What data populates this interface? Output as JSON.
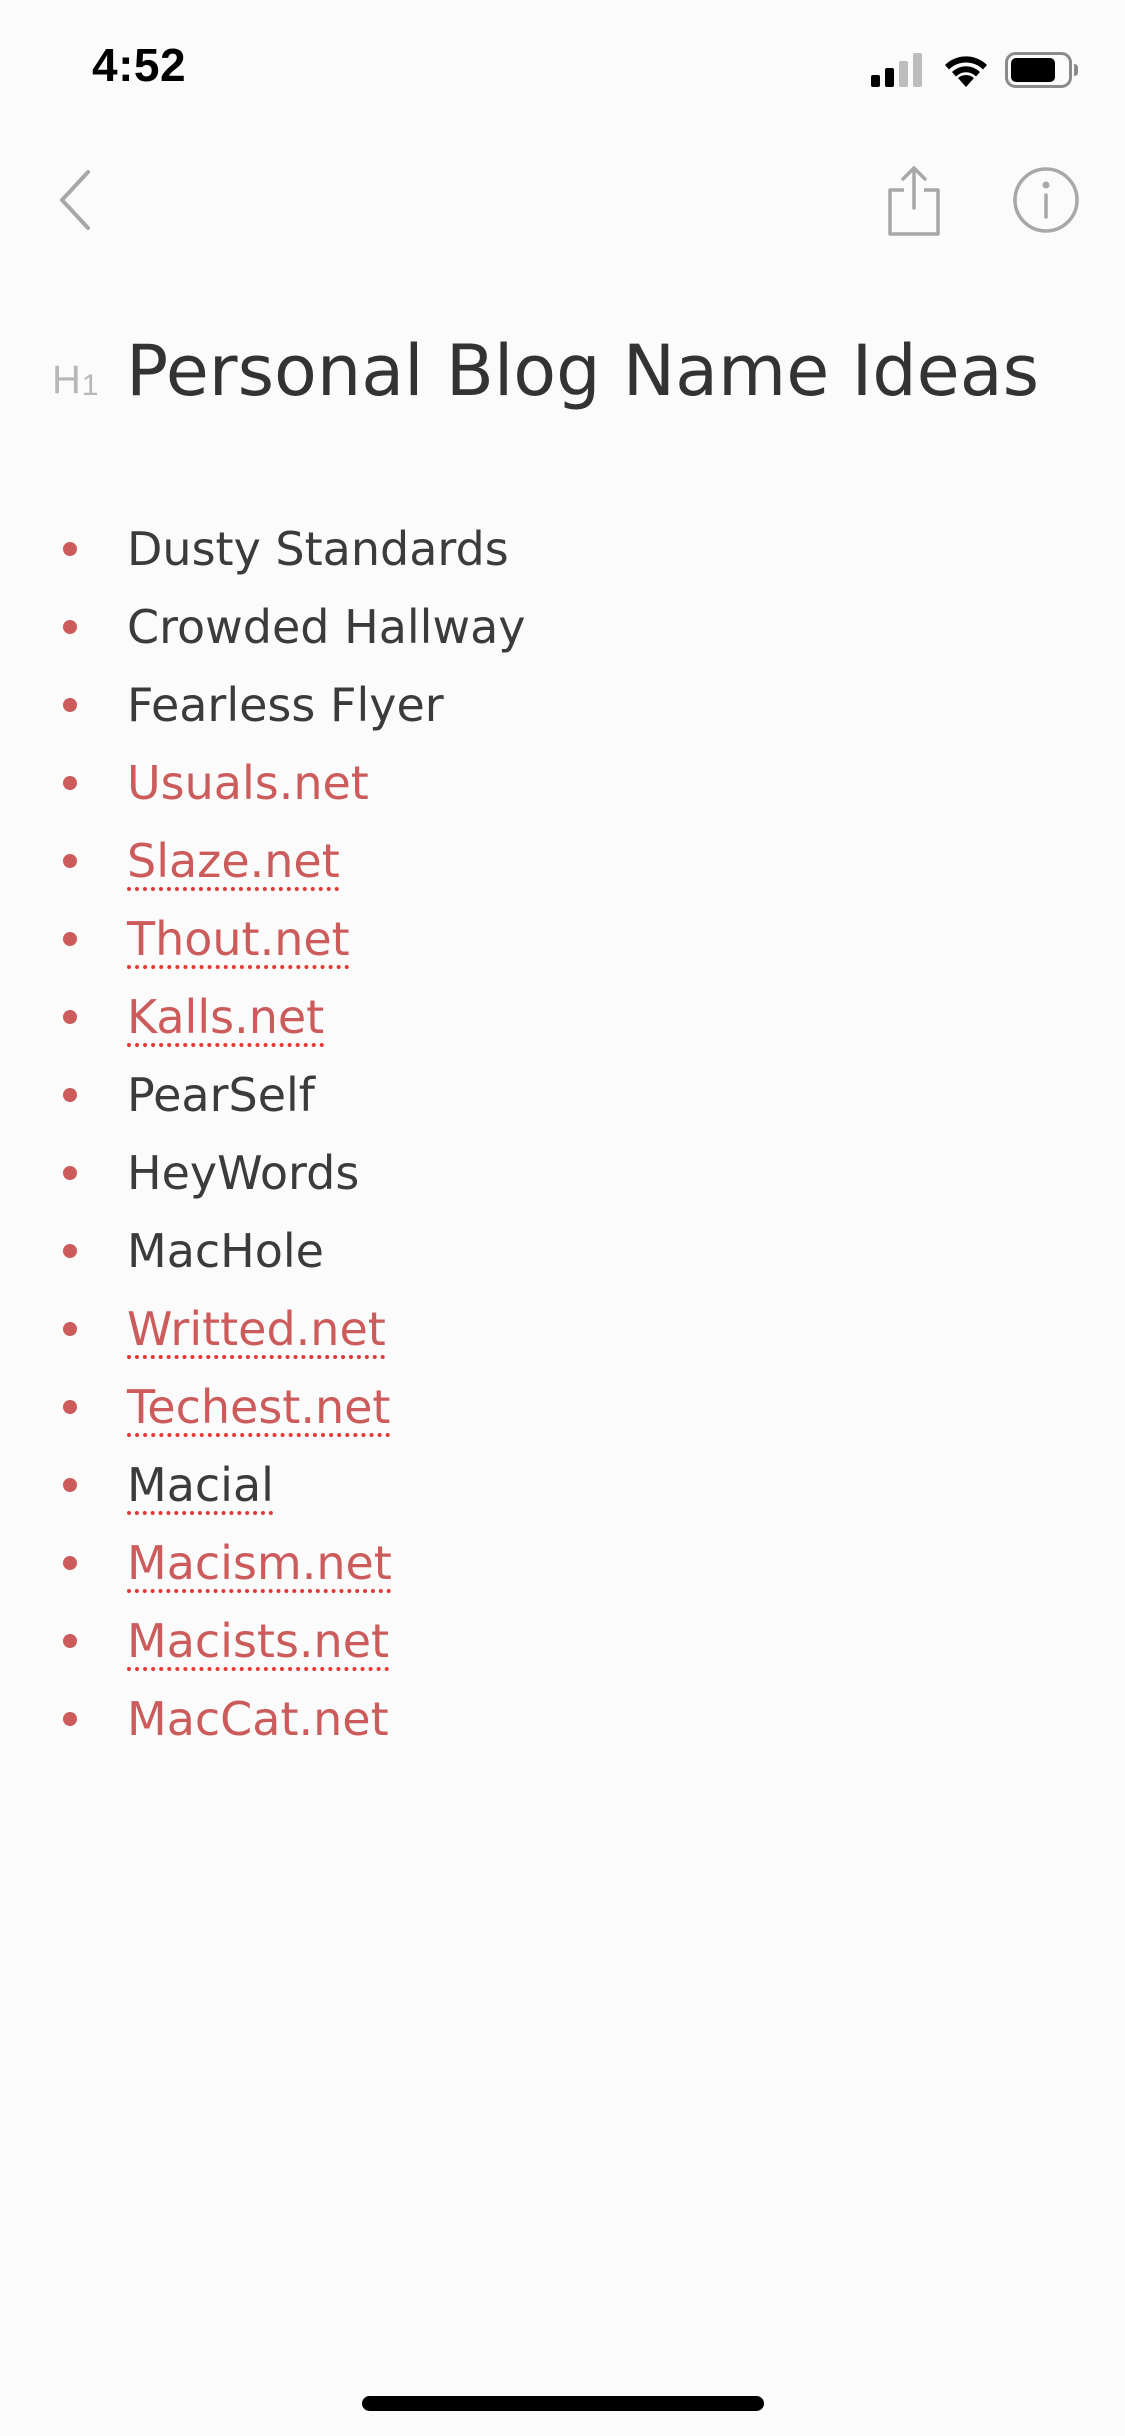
{
  "status_bar": {
    "time": "4:52",
    "signal_icon": "cellular-signal-icon",
    "wifi_icon": "wifi-icon",
    "battery_icon": "battery-icon"
  },
  "nav": {
    "back_icon": "chevron-left-icon",
    "share_icon": "share-icon",
    "info_icon": "info-icon"
  },
  "document": {
    "heading_marker": "H",
    "heading_level": "1",
    "title": "Personal Blog Name Ideas",
    "items": [
      {
        "text": "Dusty Standards",
        "link": false,
        "spell": false
      },
      {
        "text": "Crowded Hallway",
        "link": false,
        "spell": false
      },
      {
        "text": "Fearless Flyer",
        "link": false,
        "spell": false
      },
      {
        "text": "Usuals.net",
        "link": true,
        "spell": false
      },
      {
        "text": "Slaze.net",
        "link": true,
        "spell": true
      },
      {
        "text": "Thout.net",
        "link": true,
        "spell": true
      },
      {
        "text": "Kalls.net",
        "link": true,
        "spell": true
      },
      {
        "text": "PearSelf",
        "link": false,
        "spell": false
      },
      {
        "text": "HeyWords",
        "link": false,
        "spell": false
      },
      {
        "text": "MacHole",
        "link": false,
        "spell": false
      },
      {
        "text": "Writted.net",
        "link": true,
        "spell": true
      },
      {
        "text": "Techest.net",
        "link": true,
        "spell": true
      },
      {
        "text": "Macial",
        "link": false,
        "spell": true
      },
      {
        "text": "Macism.net",
        "link": true,
        "spell": true
      },
      {
        "text": "Macists.net",
        "link": true,
        "spell": true
      },
      {
        "text": "MacCat.net",
        "link": true,
        "spell": false
      }
    ]
  },
  "colors": {
    "accent": "#cc5c5c",
    "text": "#333333",
    "background": "#fbfbfb",
    "icon_gray": "#a8a8a8"
  }
}
